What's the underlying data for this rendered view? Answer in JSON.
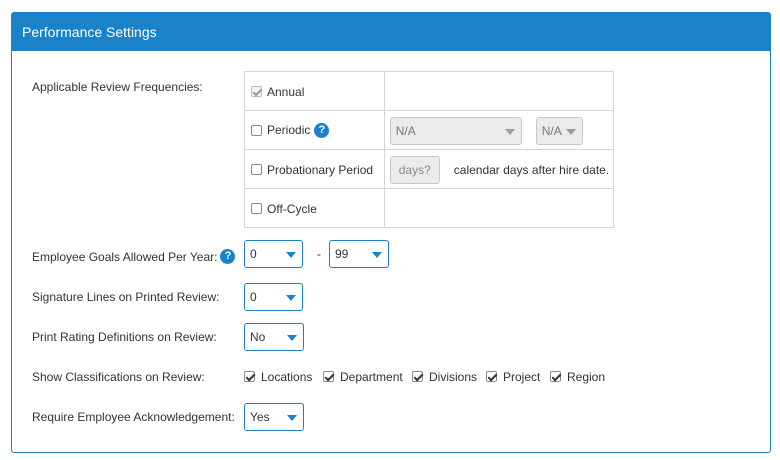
{
  "panel": {
    "title": "Performance Settings"
  },
  "colors": {
    "accent": "#1a82c8",
    "border": "#d4d4d4"
  },
  "review_frequencies": {
    "label": "Applicable Review Frequencies:",
    "annual": {
      "label": "Annual",
      "checked": true,
      "disabled": true
    },
    "periodic": {
      "label": "Periodic",
      "checked": false,
      "help_icon": "help-icon",
      "select1": "N/A",
      "select2": "N/A"
    },
    "probationary": {
      "label": "Probationary Period",
      "checked": false,
      "days_placeholder": "days?",
      "after_text": "calendar days after hire date."
    },
    "off_cycle": {
      "label": "Off-Cycle",
      "checked": false
    }
  },
  "goals": {
    "label": "Employee Goals Allowed Per Year:",
    "min": "0",
    "separator": "-",
    "max": "99",
    "help_icon": "help-icon"
  },
  "signature": {
    "label": "Signature Lines on Printed Review:",
    "value": "0"
  },
  "rating_definitions": {
    "label": "Print Rating Definitions on Review:",
    "value": "No"
  },
  "classifications": {
    "label": "Show Classifications on Review:",
    "items": [
      {
        "label": "Locations",
        "checked": true
      },
      {
        "label": "Department",
        "checked": true
      },
      {
        "label": "Divisions",
        "checked": true
      },
      {
        "label": "Project",
        "checked": true
      },
      {
        "label": "Region",
        "checked": true
      }
    ]
  },
  "acknowledgement": {
    "label": "Require Employee Acknowledgement:",
    "value": "Yes"
  }
}
